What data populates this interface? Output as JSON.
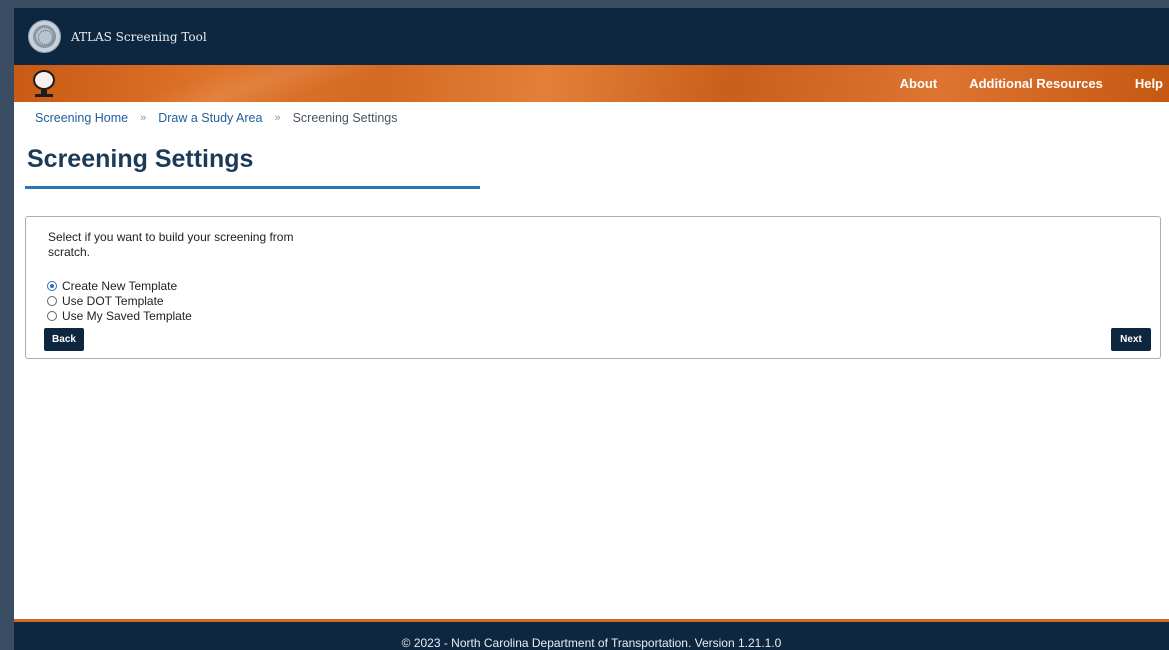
{
  "header": {
    "app_title": "ATLAS Screening Tool"
  },
  "nav": {
    "links": [
      "About",
      "Additional Resources",
      "Help"
    ]
  },
  "breadcrumb": {
    "items": [
      "Screening Home",
      "Draw a Study Area"
    ],
    "separator": "»",
    "current": "Screening Settings"
  },
  "page": {
    "title": "Screening Settings"
  },
  "card": {
    "instruction": "Select if you want to build your screening from scratch.",
    "options": [
      {
        "label": "Create New Template",
        "checked": true
      },
      {
        "label": "Use DOT Template",
        "checked": false
      },
      {
        "label": "Use My Saved Template",
        "checked": false
      }
    ],
    "back_label": "Back",
    "next_label": "Next"
  },
  "footer": {
    "text": "© 2023 - North Carolina Department of Transportation. Version 1.21.1.0"
  },
  "colors": {
    "header_navy": "#0e2741",
    "nav_orange": "#d46a22",
    "link_blue": "#1f5f99",
    "title_rule": "#2e75b6"
  }
}
